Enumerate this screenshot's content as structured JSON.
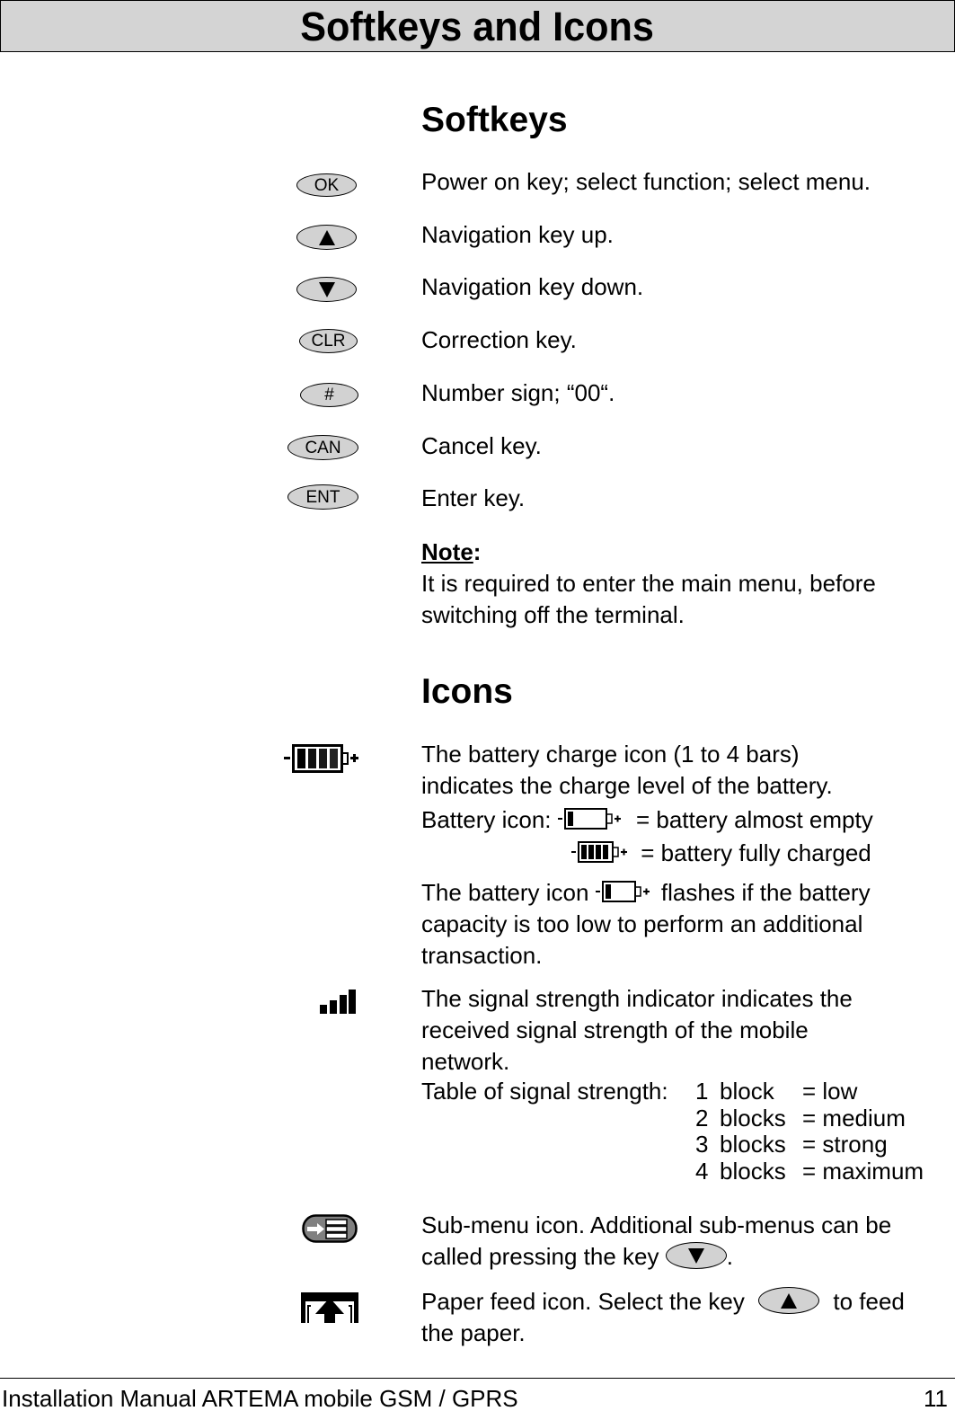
{
  "header": {
    "title": "Softkeys and Icons"
  },
  "softkeys": {
    "title": "Softkeys",
    "items": [
      {
        "key_label": "OK",
        "key_icon": "ok-key",
        "description": "Power on key; select function; select menu."
      },
      {
        "key_label": "",
        "key_icon": "up-arrow-key",
        "description": "Navigation key up."
      },
      {
        "key_label": "",
        "key_icon": "down-arrow-key",
        "description": "Navigation key down."
      },
      {
        "key_label": "CLR",
        "key_icon": "clr-key",
        "description": "Correction key."
      },
      {
        "key_label": "#",
        "key_icon": "hash-key",
        "description": "Number sign; “00“."
      },
      {
        "key_label": "CAN",
        "key_icon": "can-key",
        "description": "Cancel key."
      },
      {
        "key_label": "ENT",
        "key_icon": "ent-key",
        "description": "Enter key."
      }
    ],
    "note": {
      "label": "Note",
      "colon": ":",
      "lines": [
        "It is required to enter the main menu, before",
        "switching off the terminal."
      ]
    }
  },
  "icons": {
    "title": "Icons",
    "battery": {
      "icon": "battery-full-icon",
      "bars": 4,
      "lines": [
        "The battery charge icon (1 to 4 bars)",
        "indicates the charge level of the battery."
      ],
      "legend_label": "Battery icon:",
      "legend": [
        {
          "bars": 1,
          "text": "= battery almost empty"
        },
        {
          "bars": 4,
          "text": "= battery fully charged"
        }
      ],
      "flash_before": "The battery icon",
      "flash_after": "flashes if the battery",
      "flash_lines": [
        "capacity is too low to perform an additional",
        "transaction."
      ]
    },
    "signal": {
      "icon": "signal-strength-icon",
      "lines": [
        "The signal strength indicator indicates the",
        "received signal strength of the mobile",
        "network."
      ],
      "table_label": "Table of signal strength:",
      "table": [
        {
          "num": "1",
          "blocks": "block",
          "level": "= low"
        },
        {
          "num": "2",
          "blocks": "blocks",
          "level": "= medium"
        },
        {
          "num": "3",
          "blocks": "blocks",
          "level": "= strong"
        },
        {
          "num": "4",
          "blocks": "blocks",
          "level": "= maximum"
        }
      ]
    },
    "submenu": {
      "icon": "submenu-icon",
      "line1": "Sub-menu icon. Additional sub-menus can be",
      "line2_before": "called pressing the key",
      "line2_after": "."
    },
    "paperfeed": {
      "icon": "paper-feed-icon",
      "line1_before": "Paper feed icon. Select the key",
      "line1_after": "to feed",
      "line2": "the paper."
    }
  },
  "footer": {
    "left": "Installation Manual ARTEMA mobile GSM / GPRS",
    "page_number": "11"
  }
}
